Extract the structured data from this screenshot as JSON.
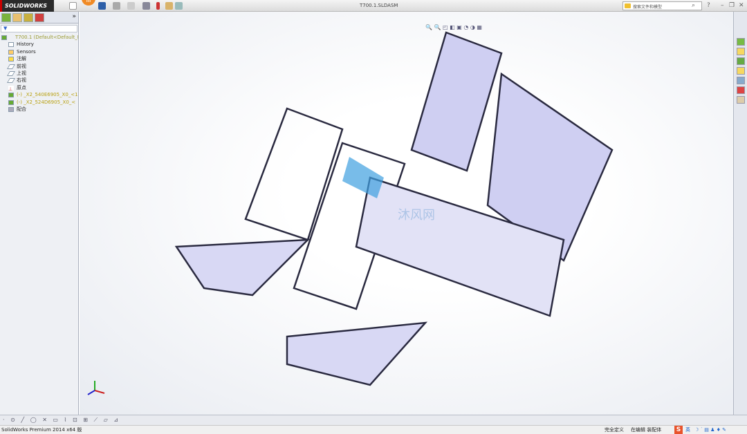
{
  "app": {
    "logo": "SOLIDWORKS",
    "badge": "IIII",
    "document_title": "T700.1.SLDASM"
  },
  "search": {
    "placeholder": "搜索文件和模型"
  },
  "feature_tree": {
    "filter_icon": "filter-icon",
    "root": "T700.1  (Default<Default_D",
    "items": [
      {
        "label": "History",
        "icon": "history-icon"
      },
      {
        "label": "Sensors",
        "icon": "sensors-icon"
      },
      {
        "label": "注解",
        "icon": "annotations-icon"
      },
      {
        "label": "前视",
        "icon": "plane-icon"
      },
      {
        "label": "上视",
        "icon": "plane-icon"
      },
      {
        "label": "右视",
        "icon": "plane-icon"
      },
      {
        "label": "原点",
        "icon": "origin-icon"
      },
      {
        "label": "(-) _X2_540E6905_X0_<1",
        "icon": "part-icon"
      },
      {
        "label": "(-) _X2_524D6905_X0_<",
        "icon": "part-icon"
      },
      {
        "label": "配合",
        "icon": "mates-icon"
      }
    ]
  },
  "status_bar": {
    "product": "SolidWorks Premium 2014 x64 版",
    "state": "完全定义",
    "editing": "在编辑 装配体",
    "ime_lang": "英",
    "ime_logo": "S"
  },
  "watermark": "沐风网",
  "colors": {
    "model": "#c8c8ee",
    "accent": "#f08a24",
    "logo_bg": "#2b2b2b"
  }
}
